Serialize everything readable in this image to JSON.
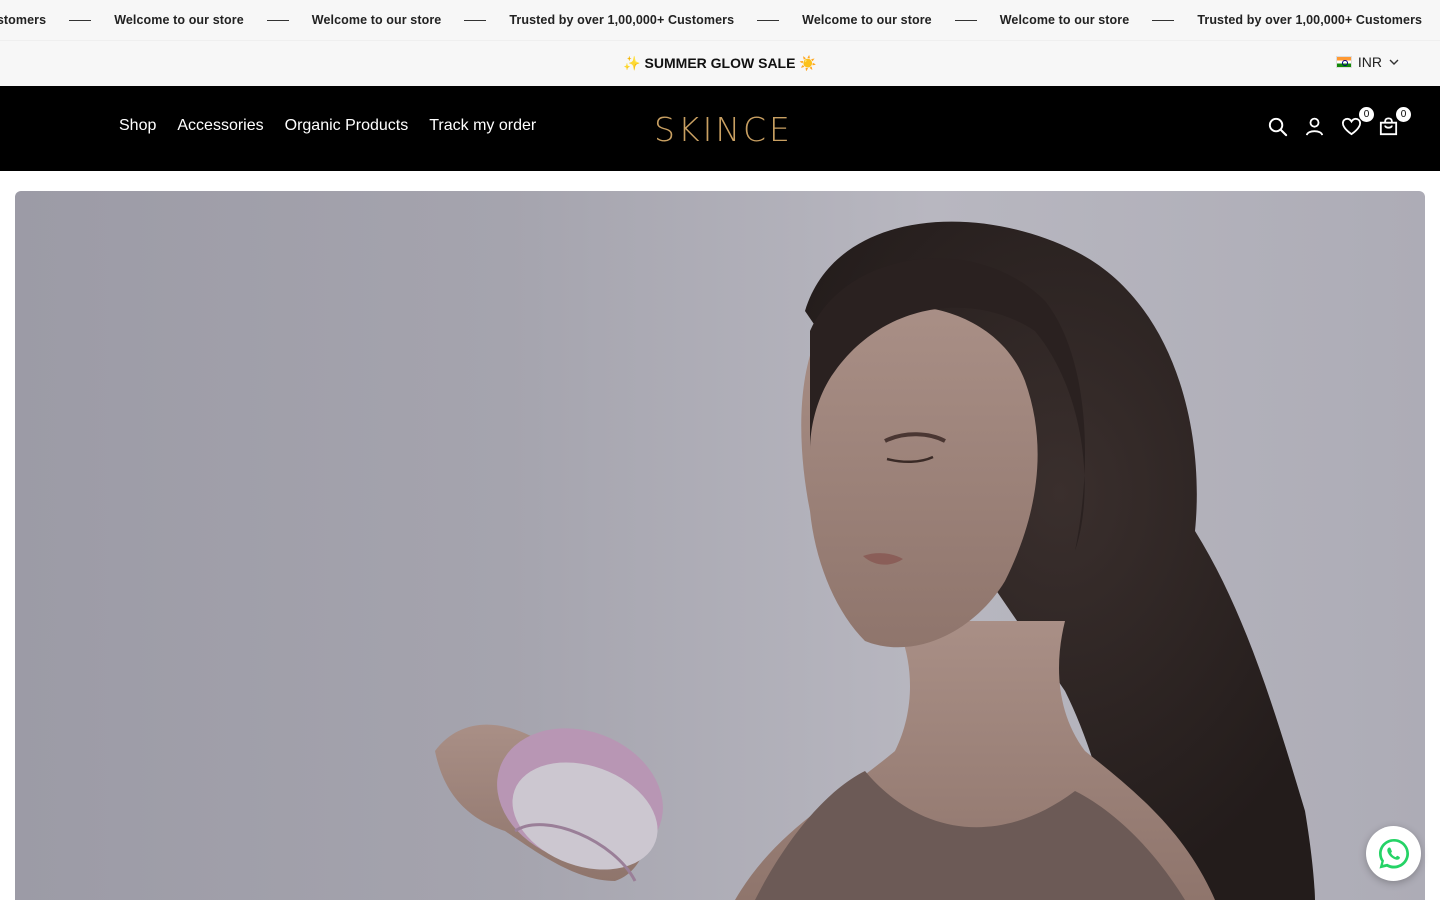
{
  "marquee": {
    "items": [
      "Customers",
      "Welcome to our store",
      "Welcome to our store",
      "Trusted by over 1,00,000+ Customers",
      "Welcome to our store",
      "Welcome to our store",
      "Trusted by over 1,00,000+ Customers"
    ]
  },
  "announcement": {
    "text": "✨ SUMMER GLOW SALE ☀️"
  },
  "currency": {
    "code": "INR",
    "flag_icon": "india-flag-icon"
  },
  "header": {
    "nav": [
      "Shop",
      "Accessories",
      "Organic Products",
      "Track my order"
    ],
    "logo_text": "SKINCE",
    "wishlist_count": "0",
    "cart_count": "0",
    "logo_color": "#c9a062",
    "background": "#000000"
  },
  "icons": {
    "search": "search-icon",
    "account": "user-icon",
    "wishlist": "heart-icon",
    "cart": "shopping-bag-icon",
    "whatsapp": "whatsapp-icon"
  }
}
